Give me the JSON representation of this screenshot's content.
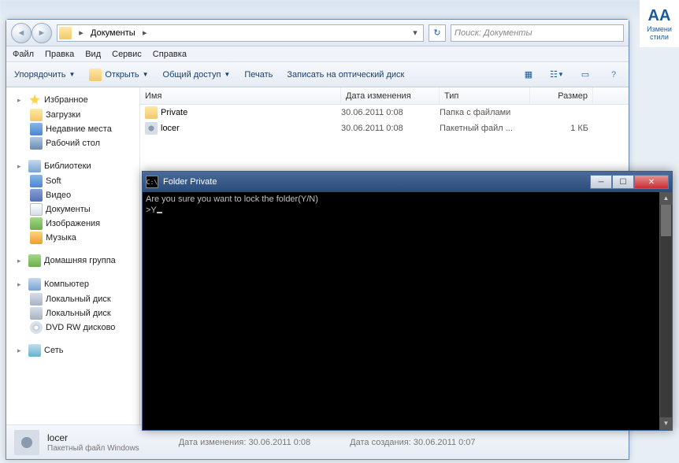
{
  "bg": {
    "aa": "AA",
    "label1": "Измени",
    "label2": "стили"
  },
  "nav": {
    "path": "Документы",
    "search_ph": "Поиск: Документы"
  },
  "menu": [
    "Файл",
    "Правка",
    "Вид",
    "Сервис",
    "Справка"
  ],
  "toolbar": {
    "organize": "Упорядочить",
    "open": "Открыть",
    "share": "Общий доступ",
    "print": "Печать",
    "burn": "Записать на оптический диск"
  },
  "sidebar": {
    "fav": {
      "head": "Избранное",
      "items": [
        "Загрузки",
        "Недавние места",
        "Рабочий стол"
      ]
    },
    "lib": {
      "head": "Библиотеки",
      "items": [
        "Soft",
        "Видео",
        "Документы",
        "Изображения",
        "Музыка"
      ]
    },
    "home": {
      "head": "Домашняя группа"
    },
    "comp": {
      "head": "Компьютер",
      "items": [
        "Локальный диск",
        "Локальный диск",
        "DVD RW дисково"
      ]
    },
    "net": {
      "head": "Сеть"
    }
  },
  "cols": {
    "name": "Имя",
    "date": "Дата изменения",
    "type": "Тип",
    "size": "Размер"
  },
  "rows": [
    {
      "name": "Private",
      "date": "30.06.2011 0:08",
      "type": "Папка с файлами",
      "size": ""
    },
    {
      "name": "locer",
      "date": "30.06.2011 0:08",
      "type": "Пакетный файл ...",
      "size": "1 КБ"
    }
  ],
  "status": {
    "name": "locer",
    "type": "Пакетный файл Windows",
    "m1l": "Дата изменения:",
    "m1v": "30.06.2011 0:08",
    "m2l": "Дата создания:",
    "m2v": "30.06.2011 0:07"
  },
  "cmd": {
    "title": "Folder Private",
    "line1": "Are you sure you want to lock the folder(Y/N)",
    "line2": ">Y"
  }
}
